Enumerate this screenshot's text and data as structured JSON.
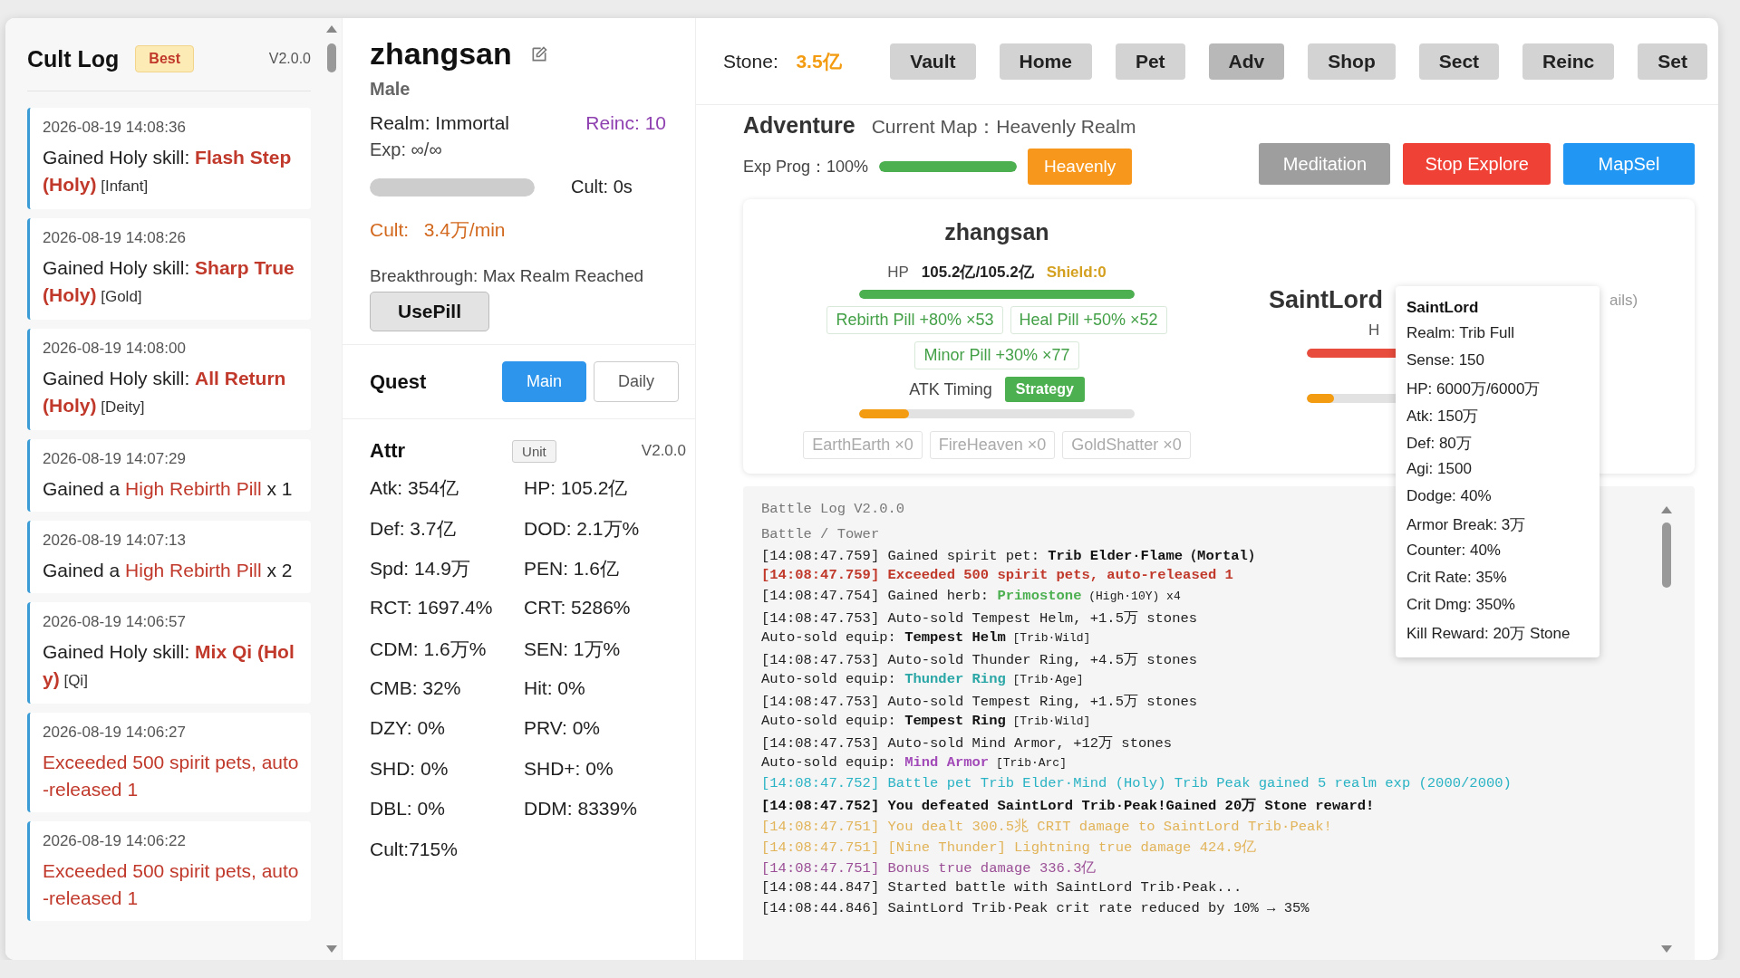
{
  "log_panel": {
    "title": "Cult Log",
    "badge": "Best",
    "version": "V2.0.0",
    "entries": [
      {
        "time": "2026-08-19 14:08:36",
        "parts": [
          {
            "text": "Gained Holy skill: ",
            "kind": "plain"
          },
          {
            "text": "Flash Step (Holy)",
            "kind": "skill"
          },
          {
            "text": " [Infant]",
            "kind": "tag"
          }
        ]
      },
      {
        "time": "2026-08-19 14:08:26",
        "parts": [
          {
            "text": "Gained Holy skill: ",
            "kind": "plain"
          },
          {
            "text": "Sharp True (Holy)",
            "kind": "skill"
          },
          {
            "text": " [Gold]",
            "kind": "tag"
          }
        ]
      },
      {
        "time": "2026-08-19 14:08:00",
        "parts": [
          {
            "text": "Gained Holy skill: ",
            "kind": "plain"
          },
          {
            "text": "All Return (Holy)",
            "kind": "skill"
          },
          {
            "text": " [Deity]",
            "kind": "tag"
          }
        ]
      },
      {
        "time": "2026-08-19 14:07:29",
        "parts": [
          {
            "text": "Gained a ",
            "kind": "plain"
          },
          {
            "text": "High Rebirth Pill",
            "kind": "item"
          },
          {
            "text": " x 1",
            "kind": "plain"
          }
        ]
      },
      {
        "time": "2026-08-19 14:07:13",
        "parts": [
          {
            "text": "Gained a ",
            "kind": "plain"
          },
          {
            "text": "High Rebirth Pill",
            "kind": "item"
          },
          {
            "text": " x 2",
            "kind": "plain"
          }
        ]
      },
      {
        "time": "2026-08-19 14:06:57",
        "parts": [
          {
            "text": "Gained Holy skill: ",
            "kind": "plain"
          },
          {
            "text": "Mix Qi (Holy)",
            "kind": "skill"
          },
          {
            "text": " [Qi]",
            "kind": "tag"
          }
        ]
      },
      {
        "time": "2026-08-19 14:06:27",
        "parts": [
          {
            "text": "Exceeded 500 spirit pets, auto-released 1",
            "kind": "item"
          }
        ]
      },
      {
        "time": "2026-08-19 14:06:22",
        "parts": [
          {
            "text": "Exceeded 500 spirit pets, auto-released 1",
            "kind": "item"
          }
        ]
      }
    ]
  },
  "profile": {
    "name": "zhangsan",
    "gender": "Male",
    "realm": "Realm: Immortal",
    "reinc": "Reinc: 10",
    "exp": "Exp: ∞/∞",
    "cult_bar": {
      "level": 1
    },
    "cult_time": "Cult: 0s",
    "cult_rate_label": "Cult:",
    "cult_rate": "3.4万/min",
    "breakthrough": "Breakthrough: Max Realm Reached",
    "use_pill": "UsePill"
  },
  "quest": {
    "title": "Quest",
    "tabs": [
      {
        "label": "Main",
        "selected": true
      },
      {
        "label": "Daily",
        "selected": false
      }
    ]
  },
  "attr": {
    "title": "Attr",
    "unit_button": "Unit",
    "version": "V2.0.0",
    "items": [
      "Atk: 354亿",
      "HP: 105.2亿",
      "Def: 3.7亿",
      "DOD: 2.1万%",
      "Spd: 14.9万",
      "PEN: 1.6亿",
      "RCT: 1697.4%",
      "CRT: 5286%",
      "CDM: 1.6万%",
      "SEN: 1万%",
      "CMB: 32%",
      "Hit: 0%",
      "DZY: 0%",
      "PRV: 0%",
      "SHD: 0%",
      "SHD+: 0%",
      "DBL: 0%",
      "DDM: 8339%",
      "Cult:715%"
    ]
  },
  "top_bar": {
    "stone_label": "Stone:",
    "stone": "3.5亿",
    "nav": [
      {
        "label": "Vault",
        "selected": false
      },
      {
        "label": "Home",
        "selected": false
      },
      {
        "label": "Pet",
        "selected": false
      },
      {
        "label": "Adv",
        "selected": true
      },
      {
        "label": "Shop",
        "selected": false
      },
      {
        "label": "Sect",
        "selected": false
      },
      {
        "label": "Reinc",
        "selected": false
      },
      {
        "label": "Set",
        "selected": false
      }
    ]
  },
  "adventure": {
    "title": "Adventure",
    "map": "Current Map：Heavenly Realm",
    "exp_prog": "Exp Prog：100%",
    "exp_bar": {
      "level": 1
    },
    "map_badge": "Heavenly",
    "actions": [
      {
        "label": "Meditation",
        "kind": "neutral"
      },
      {
        "label": "Stop Explore",
        "kind": "danger"
      },
      {
        "label": "MapSel",
        "kind": "primary"
      }
    ]
  },
  "battle": {
    "player": {
      "name": "zhangsan",
      "hp_label": "HP",
      "hp": "105.2亿/105.2亿",
      "shield": "Shield:0",
      "hp_bar": {
        "level": 1
      },
      "pills": [
        "Rebirth Pill +80% ×53",
        "Heal Pill +50% ×52",
        "Minor Pill +30% ×77"
      ],
      "atk_timing": "ATK Timing",
      "strategy": "Strategy",
      "atk_bar": {
        "level": 0.18
      },
      "skills": [
        "EarthEarth ×0",
        "FireHeaven ×0",
        "GoldShatter ×0"
      ]
    },
    "enemy": {
      "name": "SaintLord",
      "details_fragment": "ails)",
      "hp_label_fragment": "H",
      "hp_bar": {
        "level": 1
      },
      "atk_bar": {
        "level": 0.1
      }
    },
    "tooltip": {
      "title": "SaintLord",
      "lines": [
        "Realm: Trib Full",
        "Sense: 150",
        "HP: 6000万/6000万",
        "Atk: 150万",
        "Def: 80万",
        "Agi: 1500",
        "Dodge: 40%",
        "Armor Break: 3万",
        "Counter: 40%",
        "Crit Rate: 35%",
        "Crit Dmg: 350%",
        "Kill Reward: 20万 Stone"
      ]
    }
  },
  "battle_log": {
    "title": "Battle Log V2.0.0",
    "subtitle": "Battle / Tower",
    "lines": [
      {
        "kind": "normal",
        "parts": [
          {
            "text": "[14:08:47.759] Gained spirit pet: ",
            "kind": "plain"
          },
          {
            "text": "Trib Elder·Flame（Mortal）",
            "kind": "bold"
          }
        ]
      },
      {
        "kind": "alert",
        "parts": [
          {
            "text": "[14:08:47.759] Exceeded 500 spirit pets, auto-released 1",
            "kind": "plain"
          }
        ]
      },
      {
        "kind": "normal",
        "parts": [
          {
            "text": "[14:08:47.754] Gained herb: ",
            "kind": "plain"
          },
          {
            "text": "Primostone",
            "kind": "herb"
          },
          {
            "text": " (High·10Y) x4",
            "kind": "small"
          }
        ]
      },
      {
        "kind": "normal",
        "parts": [
          {
            "text": "[14:08:47.753] Auto-sold Tempest Helm, +1.5万 stones",
            "kind": "plain"
          }
        ]
      },
      {
        "kind": "normal",
        "parts": [
          {
            "text": "Auto-sold equip: ",
            "kind": "plain"
          },
          {
            "text": "Tempest Helm",
            "kind": "bold"
          },
          {
            "text": " [Trib·Wild]",
            "kind": "small"
          }
        ]
      },
      {
        "kind": "normal",
        "parts": [
          {
            "text": "[14:08:47.753] Auto-sold Thunder Ring, +4.5万 stones",
            "kind": "plain"
          }
        ]
      },
      {
        "kind": "normal",
        "parts": [
          {
            "text": "Auto-sold equip: ",
            "kind": "plain"
          },
          {
            "text": "Thunder Ring",
            "kind": "rare"
          },
          {
            "text": " [Trib·Age]",
            "kind": "small"
          }
        ]
      },
      {
        "kind": "normal",
        "parts": [
          {
            "text": "[14:08:47.753] Auto-sold Tempest Ring, +1.5万 stones",
            "kind": "plain"
          }
        ]
      },
      {
        "kind": "normal",
        "parts": [
          {
            "text": "Auto-sold equip: ",
            "kind": "plain"
          },
          {
            "text": "Tempest Ring",
            "kind": "bold"
          },
          {
            "text": " [Trib·Wild]",
            "kind": "small"
          }
        ]
      },
      {
        "kind": "normal",
        "parts": [
          {
            "text": "[14:08:47.753] Auto-sold Mind Armor, +12万 stones",
            "kind": "plain"
          }
        ]
      },
      {
        "kind": "normal",
        "parts": [
          {
            "text": "Auto-sold equip: ",
            "kind": "plain"
          },
          {
            "text": "Mind Armor",
            "kind": "epic"
          },
          {
            "text": " [Trib·Arc]",
            "kind": "small"
          }
        ]
      },
      {
        "kind": "pet",
        "parts": [
          {
            "text": "[14:08:47.752] Battle pet Trib Elder·Mind (Holy) Trib Peak gained 5 realm exp (2000/2000)",
            "kind": "plain"
          }
        ]
      },
      {
        "kind": "victory",
        "parts": [
          {
            "text": "[14:08:47.752] You defeated SaintLord Trib·Peak!Gained 20万 Stone reward!",
            "kind": "plain"
          }
        ]
      },
      {
        "kind": "crit",
        "parts": [
          {
            "text": "[14:08:47.751] You dealt 300.5兆 CRIT damage to SaintLord Trib·Peak!",
            "kind": "plain"
          }
        ]
      },
      {
        "kind": "crit",
        "parts": [
          {
            "text": "[14:08:47.751] [Nine Thunder] Lightning true damage 424.9亿",
            "kind": "plain"
          }
        ]
      },
      {
        "kind": "bonus",
        "parts": [
          {
            "text": "[14:08:47.751] Bonus true damage 336.3亿",
            "kind": "plain"
          }
        ]
      },
      {
        "kind": "normal",
        "parts": [
          {
            "text": "[14:08:44.847] Started battle with SaintLord Trib·Peak...",
            "kind": "plain"
          }
        ]
      },
      {
        "kind": "normal",
        "parts": [
          {
            "text": "[14:08:44.846] SaintLord Trib·Peak crit rate reduced by 10% → 35%",
            "kind": "plain"
          }
        ]
      }
    ]
  }
}
